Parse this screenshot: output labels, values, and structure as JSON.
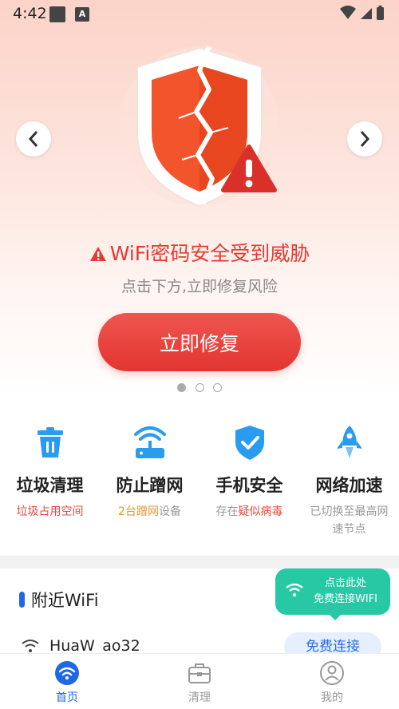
{
  "status_bar": {
    "time": "4:42",
    "notification_letter": "A"
  },
  "hero": {
    "warning_title": "WiFi密码安全受到威胁",
    "warning_subtitle": "点击下方,立即修复风险",
    "fix_button": "立即修复",
    "carousel": {
      "pages": 3,
      "active_index": 0
    }
  },
  "features": [
    {
      "title": "垃圾清理",
      "desc_parts": [
        {
          "text": "垃圾占用空间",
          "color": "#e24b3b"
        }
      ],
      "icon": "trash-icon"
    },
    {
      "title": "防止蹭网",
      "desc_parts": [
        {
          "text": "2台蹭网",
          "color": "#e0962f"
        },
        {
          "text": "设备",
          "color": "#999999"
        }
      ],
      "icon": "router-icon"
    },
    {
      "title": "手机安全",
      "desc_parts": [
        {
          "text": "存在",
          "color": "#999999"
        },
        {
          "text": "疑似病毒",
          "color": "#e24b3b"
        }
      ],
      "icon": "shield-check-icon"
    },
    {
      "title": "网络加速",
      "desc_parts": [
        {
          "text": "已切换至最高网速节点",
          "color": "#999999"
        }
      ],
      "icon": "rocket-icon"
    }
  ],
  "nearby": {
    "title": "附近WiFi",
    "networks": [
      {
        "name": "HuaW_ao32",
        "action": "免费连接"
      }
    ]
  },
  "tooltip": {
    "line1": "点击此处",
    "line2": "免费连接WIFI"
  },
  "bottom_nav": [
    {
      "label": "首页",
      "icon": "wifi-home-icon",
      "active": true
    },
    {
      "label": "清理",
      "icon": "toolbox-icon",
      "active": false
    },
    {
      "label": "我的",
      "icon": "user-icon",
      "active": false
    }
  ],
  "colors": {
    "danger": "#e53a32",
    "primary": "#2067e8",
    "teal": "#27c9a5",
    "button_red": "#e23530"
  }
}
